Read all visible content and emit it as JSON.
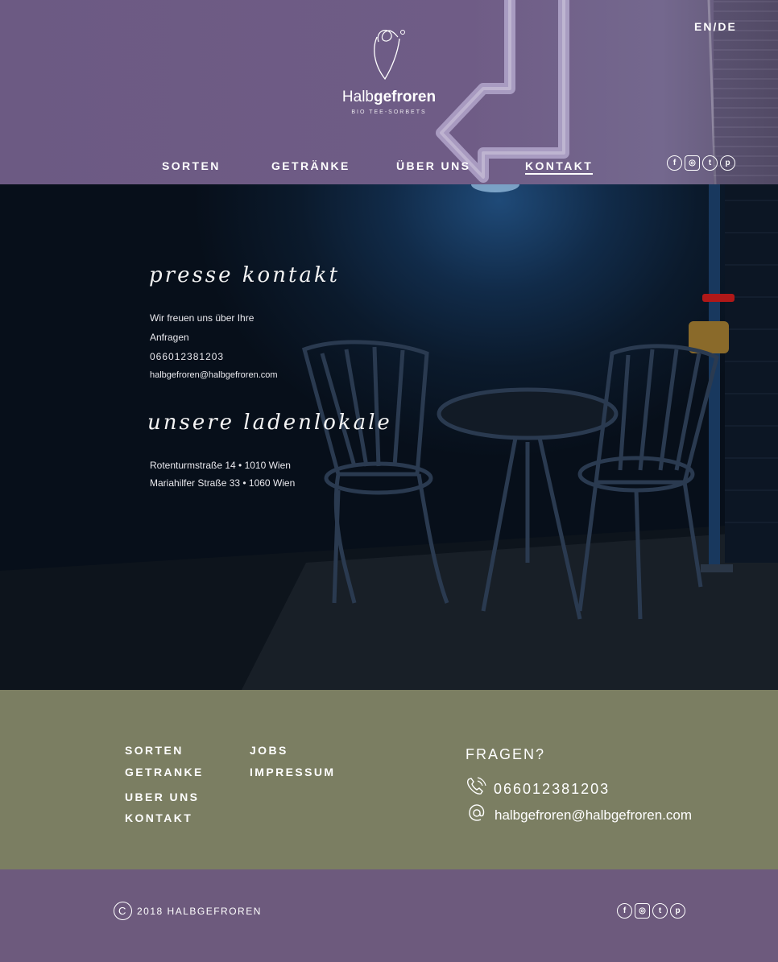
{
  "header": {
    "language_switch": "EN/DE",
    "brand": {
      "light": "Halb",
      "bold": "gefroren"
    },
    "tagline": "BIO TEE-SORBETS",
    "nav": [
      {
        "label": "SORTEN",
        "active": false
      },
      {
        "label": "GETRÄNKE",
        "active": false
      },
      {
        "label": "ÜBER UNS",
        "active": false
      },
      {
        "label": "KONTAKT",
        "active": true
      }
    ],
    "social": [
      "facebook-icon",
      "instagram-icon",
      "twitter-icon",
      "pinterest-icon"
    ]
  },
  "hero": {
    "presse_heading": "presse kontakt",
    "presse_line1": "Wir freuen uns über Ihre",
    "presse_line2": "Anfragen",
    "phone": "066012381203",
    "email": "halbgefroren@halbgefroren.com",
    "laden_heading": "unsere ladenlokale",
    "address1": "Rotenturmstraße 14 • 1010 Wien",
    "address2": "Mariahilfer Straße 33 • 1060 Wien"
  },
  "footer": {
    "links_col1": [
      "SORTEN",
      "GETRANKE",
      "UBER UNS",
      "KONTAKT"
    ],
    "links_col2": [
      "JOBS",
      "IMPRESSUM"
    ],
    "question": "FRAGEN?",
    "phone": "066012381203",
    "email": "halbgefroren@halbgefroren.com"
  },
  "bottom": {
    "copyright_symbol": "C",
    "copyright": "2018 HALBGEFROREN",
    "social": [
      "facebook-icon",
      "instagram-icon",
      "twitter-icon",
      "pinterest-icon"
    ]
  },
  "colors": {
    "header_purple": "#6f5c86",
    "footer_green": "#7b7e62",
    "bottom_purple": "#6d5a7d",
    "hero_dark": "#0b1a2c"
  }
}
